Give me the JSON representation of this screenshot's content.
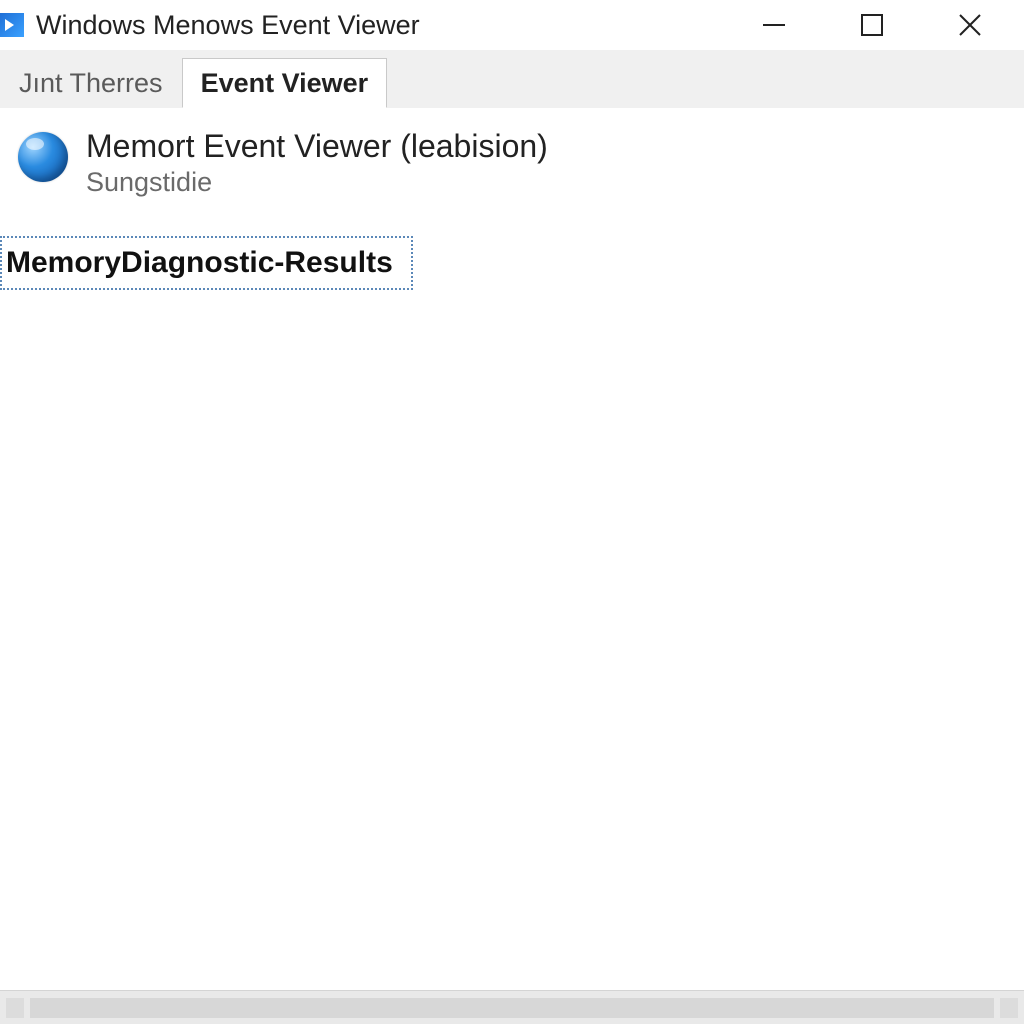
{
  "window": {
    "title": "Windows Menows Event Viewer"
  },
  "tabs": [
    {
      "label": "Jınt Therres",
      "active": false
    },
    {
      "label": "Event Viewer",
      "active": true
    }
  ],
  "header": {
    "title": "Memort Event Viewer (leabision)",
    "subtitle": "Sungstidie"
  },
  "selected_log": "MemoryDiagnostic-Results"
}
